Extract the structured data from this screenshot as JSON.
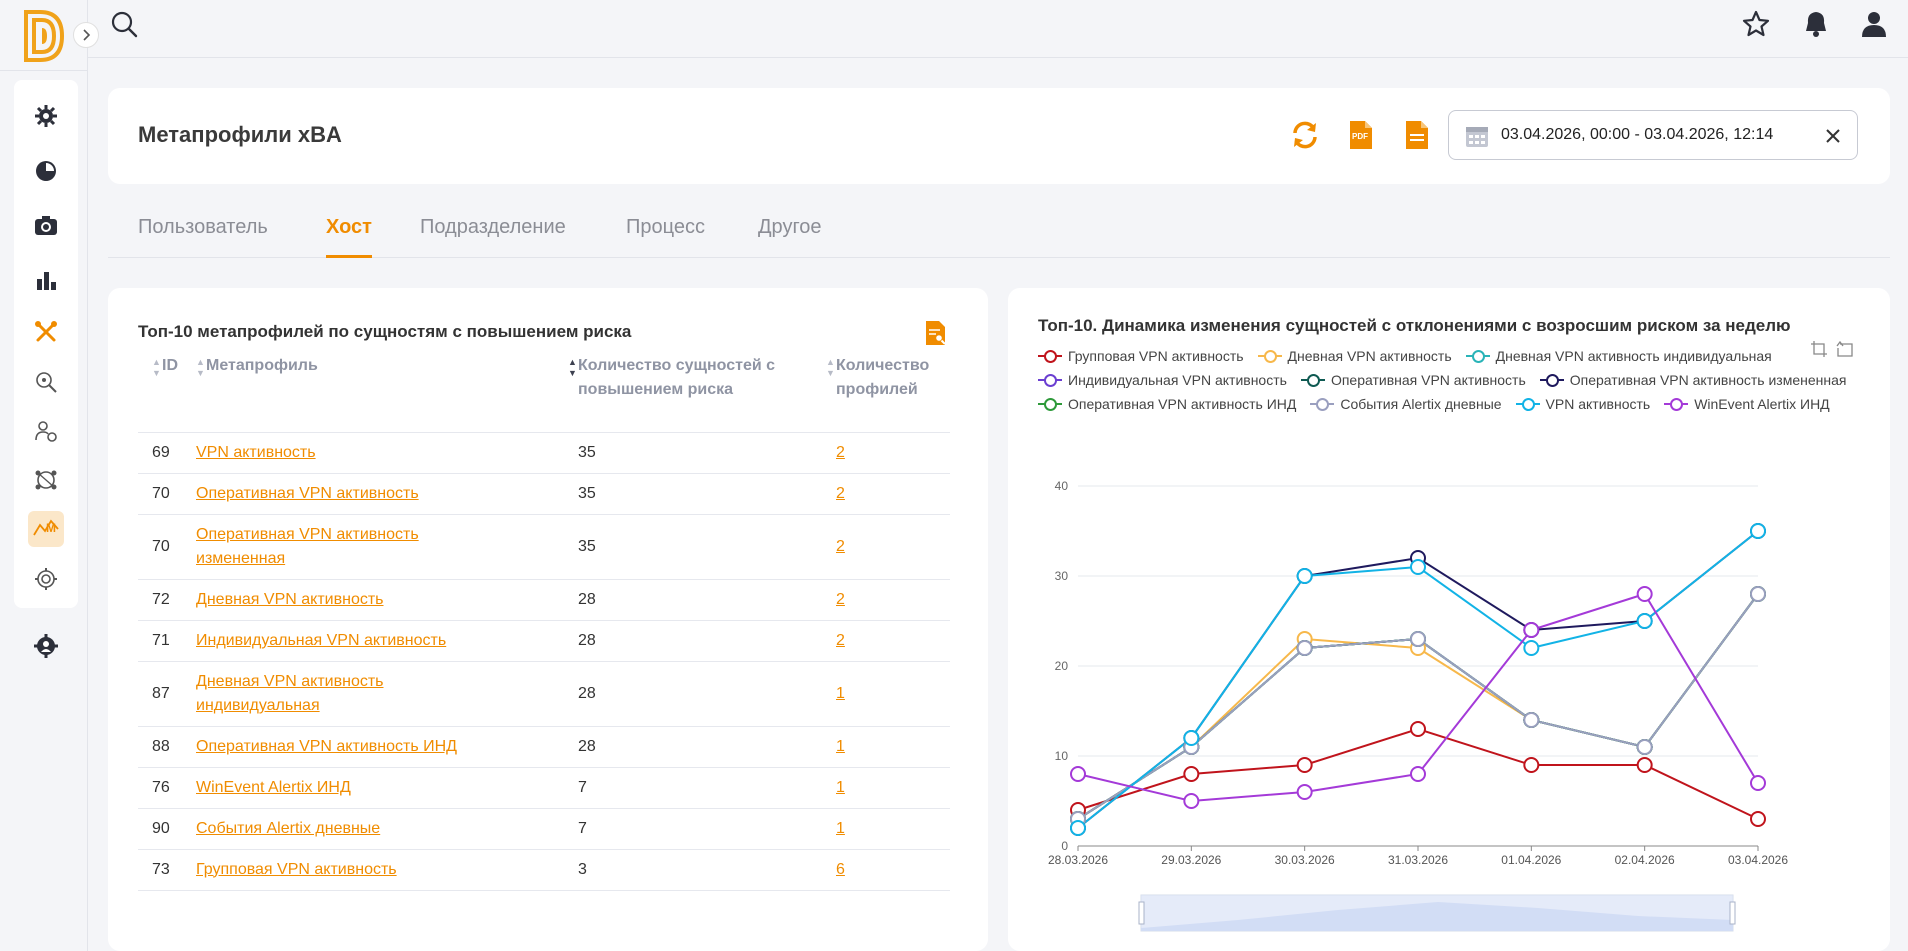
{
  "header": {
    "title": "Метапрофили xBA",
    "date_range": "03.04.2026, 00:00 - 03.04.2026, 12:14"
  },
  "tabs": [
    {
      "label": "Пользователь",
      "active": false
    },
    {
      "label": "Хост",
      "active": true
    },
    {
      "label": "Подразделение",
      "active": false
    },
    {
      "label": "Процесс",
      "active": false
    },
    {
      "label": "Другое",
      "active": false
    }
  ],
  "left_card": {
    "title": "Топ-10 метапрофилей по сущностям с повышением риска",
    "columns": [
      "ID",
      "Метапрофиль",
      "Количество сущностей с повышением риска",
      "Количество профилей"
    ],
    "rows": [
      {
        "id": "69",
        "name": "VPN активность",
        "count": "35",
        "profiles": "2"
      },
      {
        "id": "70",
        "name": "Оперативная VPN активность",
        "count": "35",
        "profiles": "2"
      },
      {
        "id": "70",
        "name": "Оперативная VPN активность измененная",
        "count": "35",
        "profiles": "2"
      },
      {
        "id": "72",
        "name": "Дневная VPN активность",
        "count": "28",
        "profiles": "2"
      },
      {
        "id": "71",
        "name": "Индивидуальная VPN активность",
        "count": "28",
        "profiles": "2"
      },
      {
        "id": "87",
        "name": "Дневная VPN активность индивидуальная",
        "count": "28",
        "profiles": "1"
      },
      {
        "id": "88",
        "name": "Оперативная VPN активность ИНД",
        "count": "28",
        "profiles": "1"
      },
      {
        "id": "76",
        "name": "WinEvent Alertix ИНД",
        "count": "7",
        "profiles": "1"
      },
      {
        "id": "90",
        "name": "События Alertix дневные",
        "count": "7",
        "profiles": "1"
      },
      {
        "id": "73",
        "name": "Групповая VPN активность",
        "count": "3",
        "profiles": "6"
      }
    ]
  },
  "chart_data": {
    "type": "line",
    "title": "Топ-10. Динамика изменения сущностей с отклонениями с возросшим риском за неделю",
    "categories": [
      "28.03.2026",
      "29.03.2026",
      "30.03.2026",
      "31.03.2026",
      "01.04.2026",
      "02.04.2026",
      "03.04.2026"
    ],
    "ylim": [
      0,
      40
    ],
    "yticks": [
      0,
      10,
      20,
      30,
      40
    ],
    "grid": true,
    "legend_position": "top",
    "series": [
      {
        "name": "Групповая VPN активность",
        "color": "#c0141c",
        "values": [
          4,
          8,
          9,
          13,
          9,
          9,
          3
        ]
      },
      {
        "name": "Дневная VPN активность",
        "color": "#f7b84b",
        "values": [
          3,
          11,
          23,
          22,
          14,
          11,
          28
        ]
      },
      {
        "name": "Дневная VPN активность индивидуальная",
        "color": "#2ab4b8",
        "values": [
          3,
          11,
          22,
          23,
          14,
          11,
          28
        ]
      },
      {
        "name": "Индивидуальная VPN активность",
        "color": "#6b3fd1",
        "values": [
          3,
          11,
          22,
          23,
          14,
          11,
          28
        ]
      },
      {
        "name": "Оперативная VPN активность",
        "color": "#0f5a52",
        "values": [
          3,
          11,
          22,
          23,
          14,
          11,
          28
        ]
      },
      {
        "name": "Оперативная VPN активность измененная",
        "color": "#1f1a5e",
        "values": [
          2,
          12,
          30,
          32,
          24,
          25,
          35
        ]
      },
      {
        "name": "Оперативная VPN активность ИНД",
        "color": "#2e9a3a",
        "values": [
          3,
          11,
          22,
          23,
          14,
          11,
          28
        ]
      },
      {
        "name": "События Alertix дневные",
        "color": "#9a9fbf",
        "values": [
          3,
          11,
          22,
          23,
          14,
          11,
          28
        ]
      },
      {
        "name": "VPN активность",
        "color": "#12b3e6",
        "values": [
          2,
          12,
          30,
          31,
          22,
          25,
          35
        ]
      },
      {
        "name": "WinEvent Alertix ИНД",
        "color": "#a43ad8",
        "values": [
          8,
          5,
          6,
          8,
          24,
          28,
          7
        ]
      }
    ]
  },
  "icons": {
    "sidebar": [
      "gear-icon",
      "pie-chart-icon",
      "camera-icon",
      "bar-chart-icon",
      "cross-tools-icon",
      "search-magnifier-icon",
      "user-settings-icon",
      "network-icon",
      "metaprofile-icon",
      "settings-cog-icon",
      "team-gear-icon"
    ],
    "accent": "#f08c00"
  }
}
